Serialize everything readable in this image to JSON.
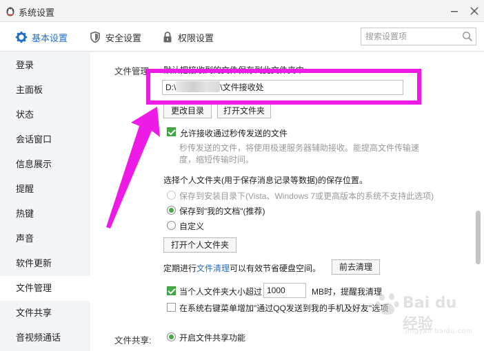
{
  "window": {
    "title": "系统设置",
    "controls": {
      "minimize_icon": "minimize-icon",
      "close_icon": "close-icon"
    }
  },
  "tabs": [
    {
      "label": "基本设置",
      "icon": "gear-icon",
      "active": true
    },
    {
      "label": "安全设置",
      "icon": "shield-icon",
      "active": false
    },
    {
      "label": "权限设置",
      "icon": "lock-icon",
      "active": false
    }
  ],
  "search": {
    "placeholder": "搜索设置项",
    "value": ""
  },
  "sidebar": {
    "items": [
      {
        "label": "登录"
      },
      {
        "label": "主面板"
      },
      {
        "label": "状态"
      },
      {
        "label": "会话窗口"
      },
      {
        "label": "信息展示"
      },
      {
        "label": "提醒"
      },
      {
        "label": "热键"
      },
      {
        "label": "声音"
      },
      {
        "label": "软件更新"
      },
      {
        "label": "文件管理",
        "active": true
      },
      {
        "label": "文件共享"
      },
      {
        "label": "音视频通话"
      }
    ]
  },
  "file_management": {
    "section_label": "文件管理:",
    "save_desc": "默认把接收到的文件保存到此文件夹中:",
    "path_prefix": "D:\\",
    "path_suffix": "\\文件接收处",
    "change_dir_button": "更改目录",
    "open_folder_button": "打开文件夹",
    "allow_fast_transfer": {
      "label": "允许接收通过秒传发送的文件",
      "checked": true
    },
    "fast_transfer_desc_line1": "秒传发送的文件，将使用极速服务器辅助接收。能提高文件传输速",
    "fast_transfer_desc_line2": "度，缩短传输时间。",
    "personal_folder_label": "选择个人文件夹(用于保存消息记录等数据)的保存位置。",
    "radio_install_dir": "保存到安装目录下(Vista、Windows 7或更高版本的系统不支持此选项)",
    "radio_my_documents": "保存到\"我的文档\"(推荐)",
    "radio_custom": "自定义",
    "open_personal_folder_button": "打开个人文件夹",
    "cleanup_prefix": "定期进行",
    "cleanup_link": "文件清理",
    "cleanup_suffix": "可以有效节省硬盘空间。",
    "go_cleanup_button": "前去清理",
    "size_reminder": {
      "prefix": "当个人文件夹大小超过",
      "value": "1000",
      "suffix": "MB时，提醒我清理",
      "checked": true
    },
    "context_menu": {
      "label": "在系统右键菜单增加\"通过QQ发送到我的手机及好友\"选项",
      "checked": false
    }
  },
  "file_sharing": {
    "section_label": "文件共享:",
    "enable_sharing": {
      "label": "开启文件共享功能",
      "checked": true
    }
  },
  "watermark": {
    "brand": "Bai du 经验",
    "url": "jingyan.baidu.com"
  },
  "colors": {
    "accent": "#1e6fc8",
    "annotation": "#ee1ae6",
    "check_green": "#44a846",
    "link": "#2a6fc9"
  }
}
